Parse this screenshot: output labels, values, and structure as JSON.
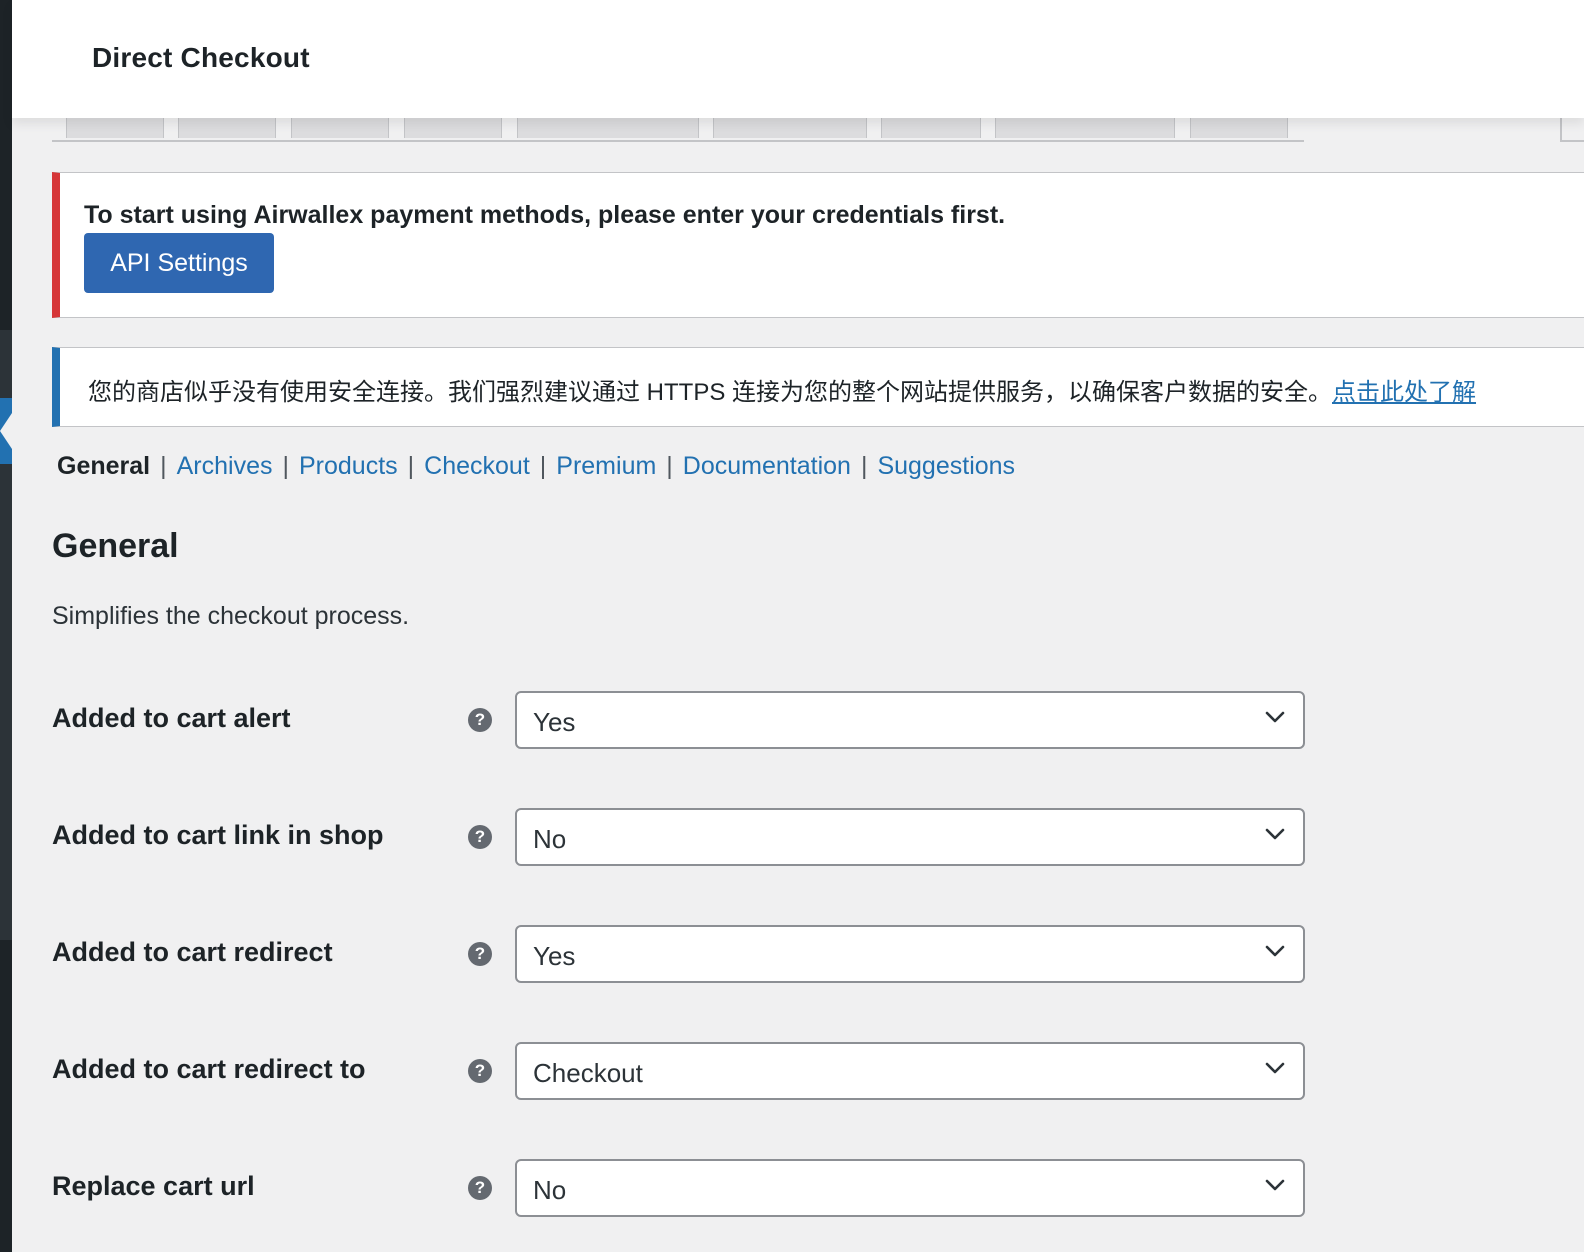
{
  "header": {
    "title": "Direct Checkout"
  },
  "notices": {
    "error": {
      "text": "To start using Airwallex payment methods, please enter your credentials first.",
      "button_label": "API Settings",
      "color": "#d63638"
    },
    "info": {
      "text": "您的商店似乎没有使用安全连接。我们强烈建议通过 HTTPS 连接为您的整个网站提供服务，以确保客户数据的安全。",
      "link_text": "点击此处了解",
      "color": "#2271b1"
    }
  },
  "subnav": {
    "items": [
      {
        "label": "General",
        "current": true
      },
      {
        "label": "Archives"
      },
      {
        "label": "Products"
      },
      {
        "label": "Checkout"
      },
      {
        "label": "Premium"
      },
      {
        "label": "Documentation"
      },
      {
        "label": "Suggestions"
      }
    ],
    "separator": "|"
  },
  "section": {
    "title": "General",
    "description": "Simplifies the checkout process."
  },
  "settings": [
    {
      "label": "Added to cart alert",
      "value": "Yes",
      "help_icon": "question-circle-icon"
    },
    {
      "label": "Added to cart link in shop",
      "value": "No",
      "help_icon": "question-circle-icon"
    },
    {
      "label": "Added to cart redirect",
      "value": "Yes",
      "help_icon": "question-circle-icon"
    },
    {
      "label": "Added to cart redirect to",
      "value": "Checkout",
      "help_icon": "question-circle-icon"
    },
    {
      "label": "Replace cart url",
      "value": "No",
      "help_icon": "question-circle-icon"
    }
  ],
  "help_glyph": "?",
  "colors": {
    "accent": "#2271b1",
    "button": "#2f67b1",
    "background": "#f0f0f1"
  }
}
